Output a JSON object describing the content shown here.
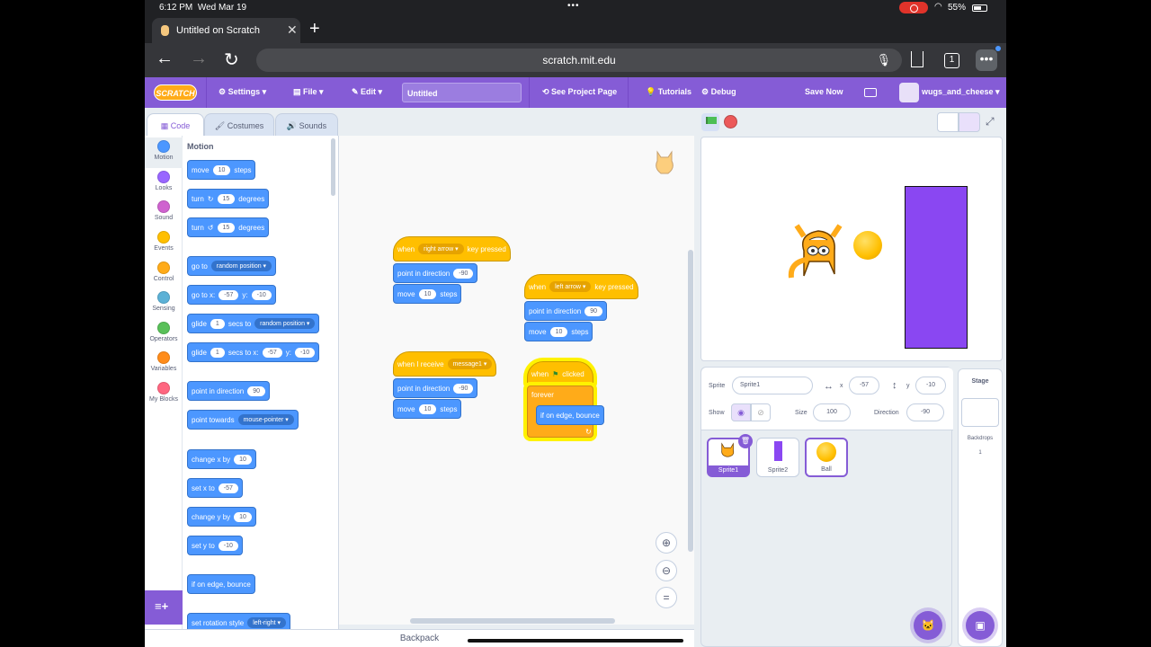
{
  "status_bar": {
    "time": "6:12 PM",
    "date": "Wed Mar 19",
    "battery": "55%"
  },
  "browser": {
    "tab_title": "Untitled on Scratch",
    "url": "scratch.mit.edu",
    "tab_count": "1"
  },
  "menubar": {
    "logo": "SCRATCH",
    "settings": "Settings",
    "file": "File",
    "edit": "Edit",
    "project_title": "Untitled",
    "see_project_page": "See Project Page",
    "tutorials": "Tutorials",
    "debug": "Debug",
    "save_now": "Save Now",
    "username": "wugs_and_cheese"
  },
  "editor_tabs": [
    "Code",
    "Costumes",
    "Sounds"
  ],
  "categories": [
    {
      "label": "Motion",
      "color": "#4c97ff"
    },
    {
      "label": "Looks",
      "color": "#9966ff"
    },
    {
      "label": "Sound",
      "color": "#cf63cf"
    },
    {
      "label": "Events",
      "color": "#ffbf00"
    },
    {
      "label": "Control",
      "color": "#ffab19"
    },
    {
      "label": "Sensing",
      "color": "#5cb1d6"
    },
    {
      "label": "Operators",
      "color": "#59c059"
    },
    {
      "label": "Variables",
      "color": "#ff8c1a"
    },
    {
      "label": "My Blocks",
      "color": "#ff6680"
    }
  ],
  "palette": {
    "heading": "Motion",
    "move": {
      "a": "move",
      "v": "10",
      "b": "steps"
    },
    "turn_right": {
      "a": "turn",
      "v": "15",
      "b": "degrees"
    },
    "turn_left": {
      "a": "turn",
      "v": "15",
      "b": "degrees"
    },
    "goto": {
      "a": "go to",
      "v": "random position"
    },
    "goto_xy": {
      "a": "go to x:",
      "x": "-57",
      "b": "y:",
      "y": "-10"
    },
    "glide_to": {
      "a": "glide",
      "v": "1",
      "b": "secs to",
      "c": "random position"
    },
    "glide_xy": {
      "a": "glide",
      "v": "1",
      "b": "secs to x:",
      "x": "-57",
      "c": "y:",
      "y": "-10"
    },
    "point_dir": {
      "a": "point in direction",
      "v": "90"
    },
    "point_towards": {
      "a": "point towards",
      "v": "mouse-pointer"
    },
    "change_x": {
      "a": "change x by",
      "v": "10"
    },
    "set_x": {
      "a": "set x to",
      "v": "-57"
    },
    "change_y": {
      "a": "change y by",
      "v": "10"
    },
    "set_y": {
      "a": "set y to",
      "v": "-10"
    },
    "bounce": {
      "a": "if on edge, bounce"
    },
    "rotation_style": {
      "a": "set rotation style",
      "v": "left-right"
    }
  },
  "scripts": {
    "s1": {
      "when": "when",
      "key": "right arrow",
      "pressed": "key pressed",
      "point": "point in direction",
      "dir": "-90",
      "move": "move",
      "steps_v": "10",
      "steps": "steps"
    },
    "s2": {
      "when": "when",
      "key": "left arrow",
      "pressed": "key pressed",
      "point": "point in direction",
      "dir": "90",
      "move": "move",
      "steps_v": "10",
      "steps": "steps"
    },
    "s3": {
      "when": "when I receive",
      "msg": "message1",
      "point": "point in direction",
      "dir": "-90",
      "move": "move",
      "steps_v": "10",
      "steps": "steps"
    },
    "s4": {
      "when": "when",
      "clicked": "clicked",
      "forever": "forever",
      "bounce": "if on edge, bounce"
    }
  },
  "sprite_info": {
    "sprite_label": "Sprite",
    "sprite_name": "Sprite1",
    "x_label": "x",
    "x": "-57",
    "y_label": "y",
    "y": "-10",
    "show_label": "Show",
    "size_label": "Size",
    "size": "100",
    "direction_label": "Direction",
    "direction": "-90"
  },
  "sprites": [
    "Sprite1",
    "Sprite2",
    "Ball"
  ],
  "stage_panel": {
    "title": "Stage",
    "backdrops_label": "Backdrops",
    "backdrops_count": "1"
  },
  "backpack": "Backpack",
  "colors": {
    "accent": "#855cd6",
    "motion": "#4c97ff",
    "events": "#ffbf00",
    "control": "#ffab19",
    "paddle": "#8a47f2"
  }
}
